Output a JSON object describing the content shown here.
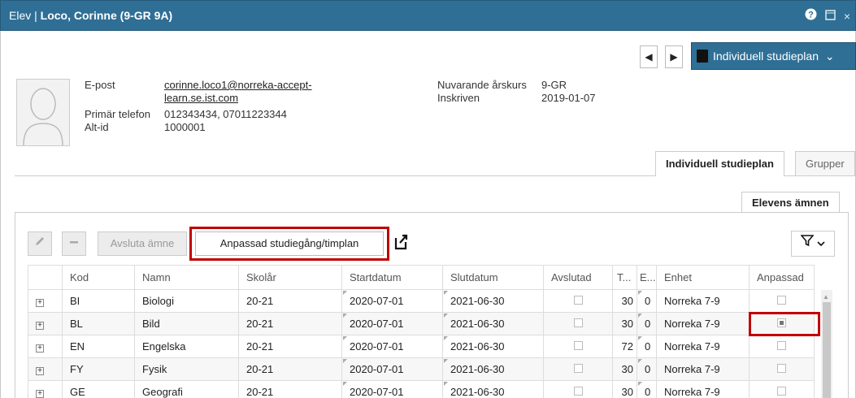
{
  "window": {
    "title_prefix": "Elev | ",
    "title_name": "Loco, Corinne (9-GR 9A)",
    "help_icon": "help-icon",
    "restore_icon": "restore-icon",
    "close_glyph": "×"
  },
  "nav": {
    "prev": "◀",
    "next": "▶",
    "plan_label": "Individuell studieplan",
    "plan_caret": "⌄"
  },
  "student": {
    "email_label": "E-post",
    "email_value_line1": "corinne.loco1@norreka-accept-",
    "email_value_line2": "learn.se.ist.com",
    "phone_label": "Primär telefon",
    "phone_value": "012343434, 07011223344",
    "altid_label": "Alt-id",
    "altid_value": "1000001",
    "grade_label": "Nuvarande årskurs",
    "grade_value": "9-GR",
    "enrolled_label": "Inskriven",
    "enrolled_value": "2019-01-07"
  },
  "tabs": {
    "main_active": "Individuell studieplan",
    "main_inactive": "Grupper",
    "sub_active": "Elevens ämnen"
  },
  "toolbar": {
    "avsluta": "Avsluta ämne",
    "anpassad": "Anpassad studiegång/timplan"
  },
  "columns": [
    "Kod",
    "Namn",
    "Skolår",
    "Startdatum",
    "Slutdatum",
    "Avslutad",
    "T...",
    "E...",
    "Enhet",
    "Anpassad"
  ],
  "rows": [
    {
      "kod": "BI",
      "namn": "Biologi",
      "skolar": "20-21",
      "start": "2020-07-01",
      "slut": "2021-06-30",
      "t": "30",
      "e": "0",
      "enhet": "Norreka 7-9",
      "avslutad": false,
      "anpassad": false
    },
    {
      "kod": "BL",
      "namn": "Bild",
      "skolar": "20-21",
      "start": "2020-07-01",
      "slut": "2021-06-30",
      "t": "30",
      "e": "0",
      "enhet": "Norreka 7-9",
      "avslutad": false,
      "anpassad": true
    },
    {
      "kod": "EN",
      "namn": "Engelska",
      "skolar": "20-21",
      "start": "2020-07-01",
      "slut": "2021-06-30",
      "t": "72",
      "e": "0",
      "enhet": "Norreka 7-9",
      "avslutad": false,
      "anpassad": false
    },
    {
      "kod": "FY",
      "namn": "Fysik",
      "skolar": "20-21",
      "start": "2020-07-01",
      "slut": "2021-06-30",
      "t": "30",
      "e": "0",
      "enhet": "Norreka 7-9",
      "avslutad": false,
      "anpassad": false
    },
    {
      "kod": "GE",
      "namn": "Geografi",
      "skolar": "20-21",
      "start": "2020-07-01",
      "slut": "2021-06-30",
      "t": "30",
      "e": "0",
      "enhet": "Norreka 7-9",
      "avslutad": false,
      "anpassad": false
    }
  ],
  "colors": {
    "header_blue": "#2f6f95",
    "highlight_red": "#c00000"
  }
}
